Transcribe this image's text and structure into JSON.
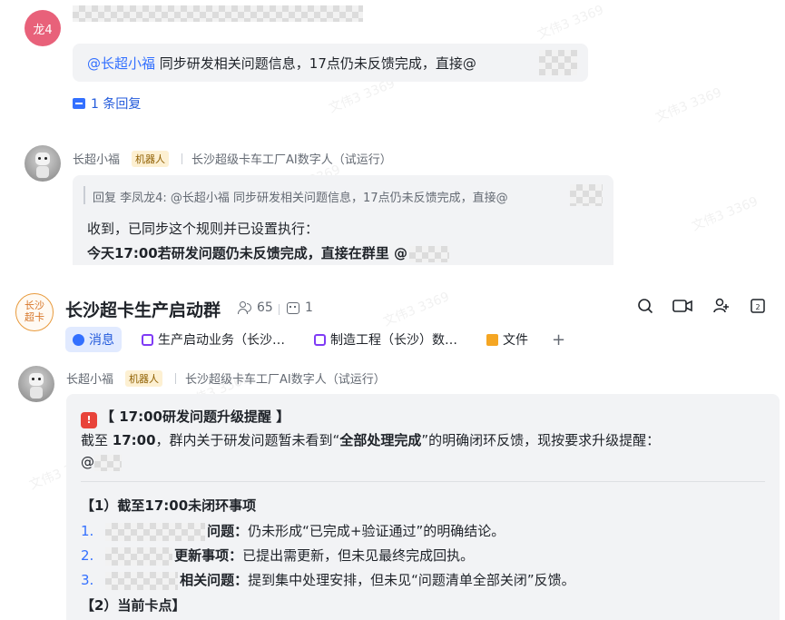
{
  "top_chat": {
    "first_message": {
      "avatar_text": "龙4",
      "mention": "@长超小福",
      "text": " 同步研发相关问题信息，17点仍未反馈完成，直接@",
      "reply_count_label": "1 条回复"
    },
    "bot_message": {
      "sender_name": "长超小福",
      "bot_tag": "机器人",
      "sender_desc": "长沙超级卡车工厂AI数字人（试运行）",
      "quote": "回复 李凤龙4: @长超小福 同步研发相关问题信息，17点仍未反馈完成，直接@",
      "line1": "收到，已同步这个规则并已设置执行：",
      "line2": "今天17:00若研发问题仍未反馈完成，直接在群里 @"
    }
  },
  "group": {
    "logo_text_line1": "长沙",
    "logo_text_line2": "超卡",
    "title": "长沙超卡生产启动群",
    "member_count": "65",
    "bot_count": "1",
    "tabs": [
      {
        "label": "消息",
        "icon": "chat-bubble-icon",
        "color": "#3370ff"
      },
      {
        "label": "生产启动业务（长沙…",
        "icon": "doc-icon",
        "color": "#7f3bf5"
      },
      {
        "label": "制造工程（长沙）数…",
        "icon": "doc-icon",
        "color": "#7f3bf5"
      },
      {
        "label": "文件",
        "icon": "folder-icon",
        "color": "#f5a623"
      }
    ],
    "add_tab_label": "+"
  },
  "bot_post": {
    "sender_name": "长超小福",
    "bot_tag": "机器人",
    "sender_desc": "长沙超级卡车工厂AI数字人（试运行）",
    "heading": "【 17:00研发问题升级提醒 】",
    "intro_prefix": "截至 ",
    "intro_time": "17:00",
    "intro_mid": "，群内关于研发问题暂未看到“",
    "intro_bold": "全部处理完成",
    "intro_suffix": "”的明确闭环反馈，现按要求升级提醒：",
    "mention_at": "@",
    "section1_title": "【1）截至17:00未闭环事项",
    "items": [
      {
        "num": "1.",
        "bold": "问题：",
        "text": "仍未形成“已完成+验证通过”的明确结论。"
      },
      {
        "num": "2.",
        "bold": "更新事项：",
        "text": "已提出需更新，但未见最终完成回执。"
      },
      {
        "num": "3.",
        "bold": "相关问题：",
        "text": "提到集中处理安排，但未见“问题清单全部关闭”反馈。"
      }
    ],
    "section2_title": "【2）当前卡点】"
  },
  "colors": {
    "accent": "#3370ff",
    "bot_tag_bg": "#fdf0d2",
    "bubble_bg": "#f2f3f5",
    "avatar_red": "#e8617a"
  }
}
